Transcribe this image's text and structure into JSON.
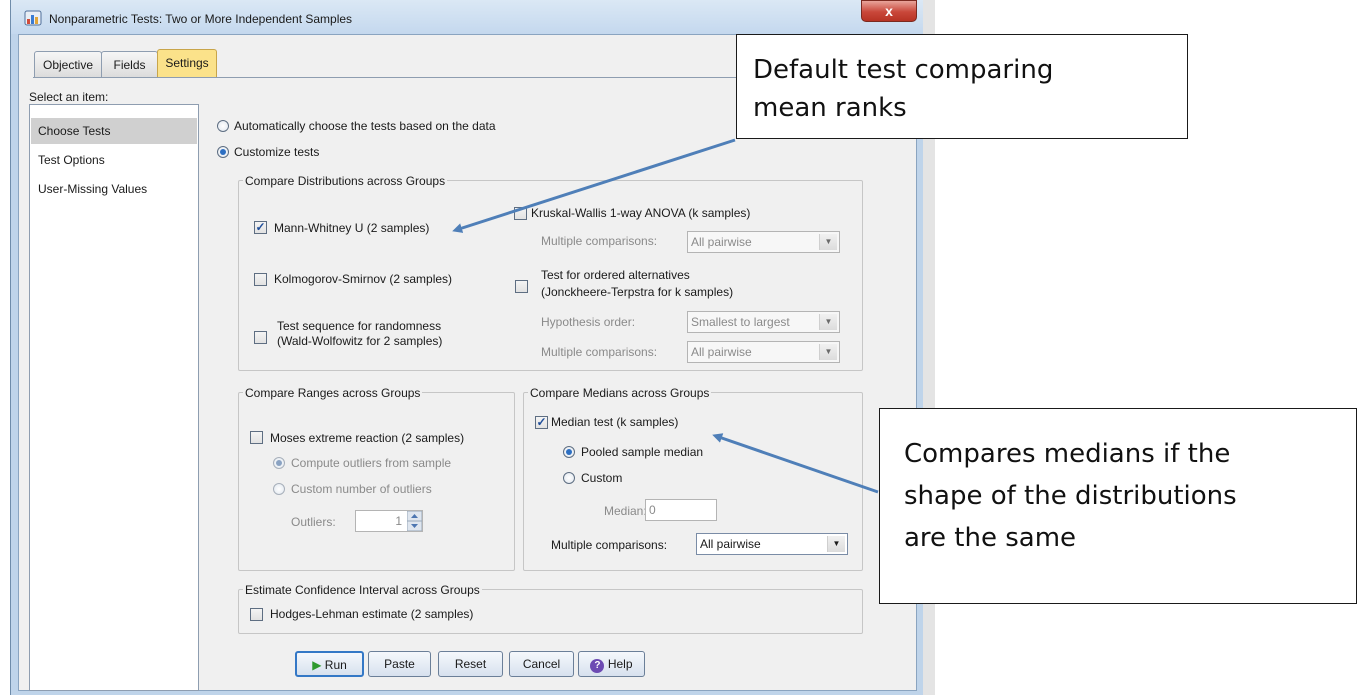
{
  "window": {
    "title": "Nonparametric Tests: Two or More Independent Samples",
    "close_label": "x"
  },
  "tabs": [
    {
      "label": "Objective"
    },
    {
      "label": "Fields"
    },
    {
      "label": "Settings"
    }
  ],
  "sidebar": {
    "select_label": "Select an item:",
    "items": [
      {
        "label": "Choose Tests"
      },
      {
        "label": "Test Options"
      },
      {
        "label": "User-Missing Values"
      }
    ]
  },
  "choose": {
    "auto_label": "Automatically choose the tests based on the data",
    "custom_label": "Customize tests",
    "selected": "custom"
  },
  "distributions": {
    "title": "Compare Distributions across Groups",
    "mann_whitney": {
      "label": "Mann-Whitney U (2 samples)",
      "checked": true
    },
    "kolmogorov": {
      "label": "Kolmogorov-Smirnov (2 samples)",
      "checked": false
    },
    "wald_line1": "Test sequence for randomness",
    "wald_line2": "(Wald-Wolfowitz for 2 samples)",
    "kruskal": {
      "label": "Kruskal-Wallis 1-way ANOVA (k samples)",
      "checked": false
    },
    "multiple_label": "Multiple comparisons:",
    "multiple_value": "All pairwise",
    "ordered_line1": "Test for ordered alternatives",
    "ordered_line2": "(Jonckheere-Terpstra for k samples)",
    "hypothesis_label": "Hypothesis order:",
    "hypothesis_value": "Smallest to largest",
    "multiple2_label": "Multiple comparisons:",
    "multiple2_value": "All pairwise"
  },
  "ranges": {
    "title": "Compare Ranges across Groups",
    "moses_label": "Moses extreme reaction (2 samples)",
    "compute_label": "Compute outliers from sample",
    "custom_label": "Custom number of outliers",
    "outliers_label": "Outliers:",
    "outliers_value": "1"
  },
  "medians": {
    "title": "Compare Medians across Groups",
    "median_test_label": "Median test (k samples)",
    "pooled_label": "Pooled sample median",
    "custom_label": "Custom",
    "median_label": "Median:",
    "median_value": "0",
    "multiple_label": "Multiple comparisons:",
    "multiple_value": "All pairwise"
  },
  "estimate": {
    "title": "Estimate Confidence Interval across Groups",
    "hodges_label": "Hodges-Lehman estimate (2 samples)"
  },
  "buttons": {
    "run": "Run",
    "paste": "Paste",
    "reset": "Reset",
    "cancel": "Cancel",
    "help": "Help"
  },
  "callouts": {
    "mean_ranks_line1": "Default test comparing",
    "mean_ranks_line2": "mean ranks",
    "medians_line1": "Compares medians if the",
    "medians_line2": "shape of the distributions",
    "medians_line3": "are the same"
  },
  "colors": {
    "settings_tab": "#fbe28a",
    "arrow": "#4f7fb8",
    "close_button": "#c9473a"
  }
}
